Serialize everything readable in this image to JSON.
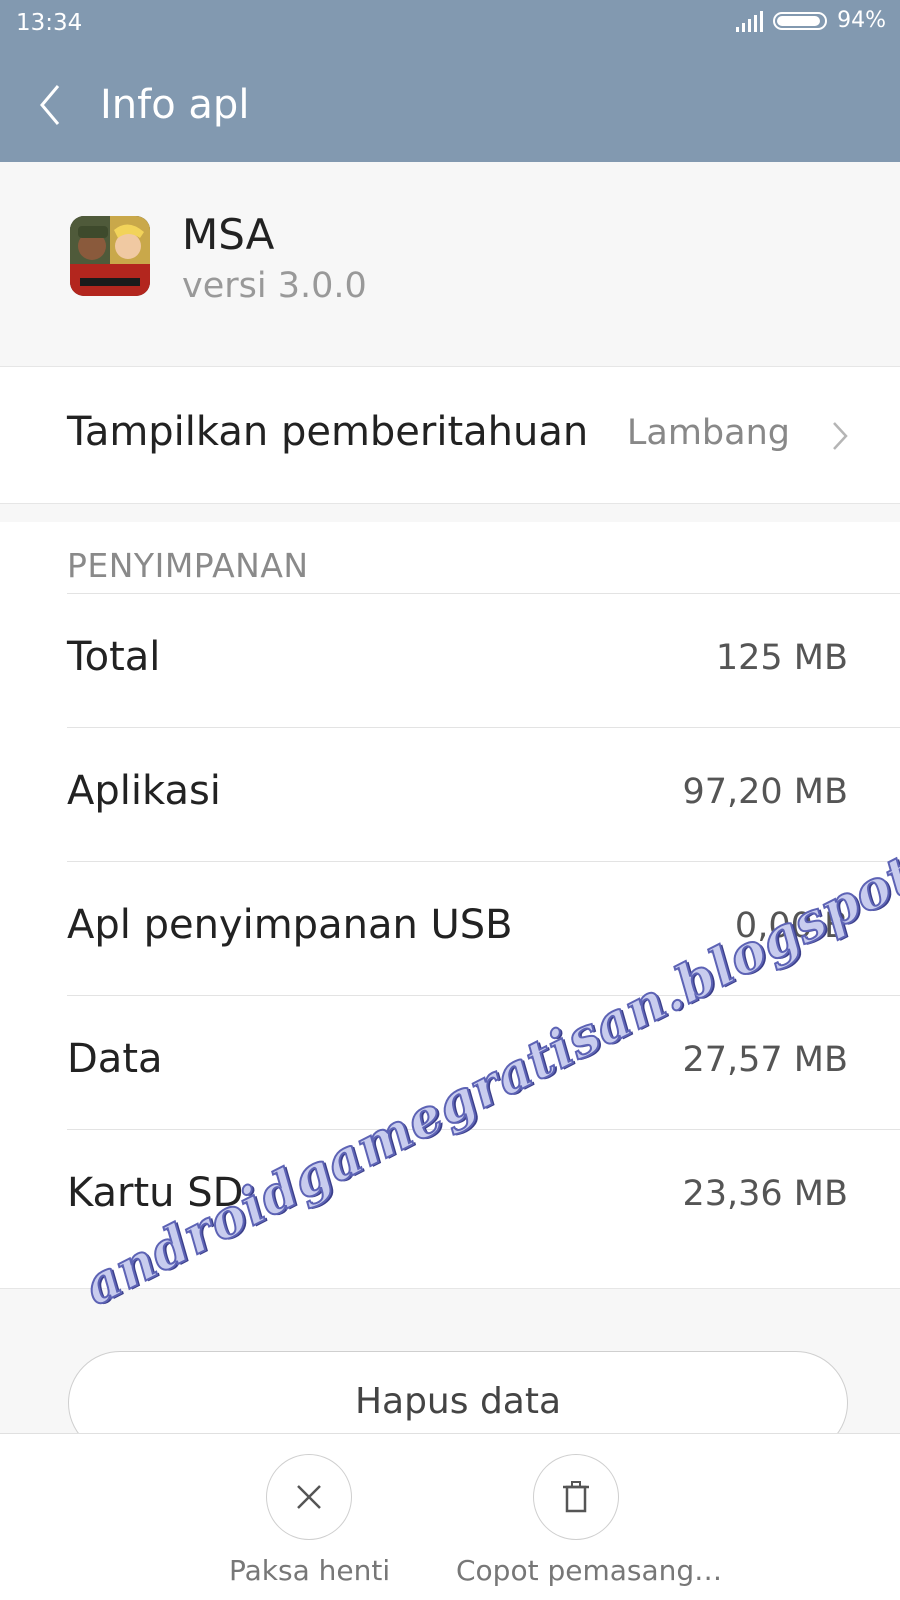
{
  "status_bar": {
    "time": "13:34",
    "battery_percent": "94%",
    "battery_level": 0.94
  },
  "header": {
    "title": "Info apl",
    "back_icon": "chevron-left-icon"
  },
  "app": {
    "name": "MSA",
    "version": "versi 3.0.0",
    "icon": "app-icon"
  },
  "notification": {
    "label": "Tampilkan pemberitahuan",
    "value": "Lambang",
    "chevron_icon": "chevron-right-icon"
  },
  "storage": {
    "title": "PENYIMPANAN",
    "rows": [
      {
        "label": "Total",
        "value": "125 MB"
      },
      {
        "label": "Aplikasi",
        "value": "97,20 MB"
      },
      {
        "label": "Apl penyimpanan USB",
        "value": "0,00 B"
      },
      {
        "label": "Data",
        "value": "27,57 MB"
      },
      {
        "label": "Kartu SD",
        "value": "23,36 MB"
      }
    ]
  },
  "buttons": {
    "clear_data": "Hapus data"
  },
  "actions": [
    {
      "label": "Paksa henti",
      "icon": "close-icon"
    },
    {
      "label": "Copot pemasang…",
      "icon": "trash-icon"
    }
  ],
  "watermark": "androidgamegratisan.blogspot.com",
  "colors": {
    "header_bg": "#8299b0",
    "section_bg": "#f7f7f7",
    "divider": "#e3e3e3"
  }
}
